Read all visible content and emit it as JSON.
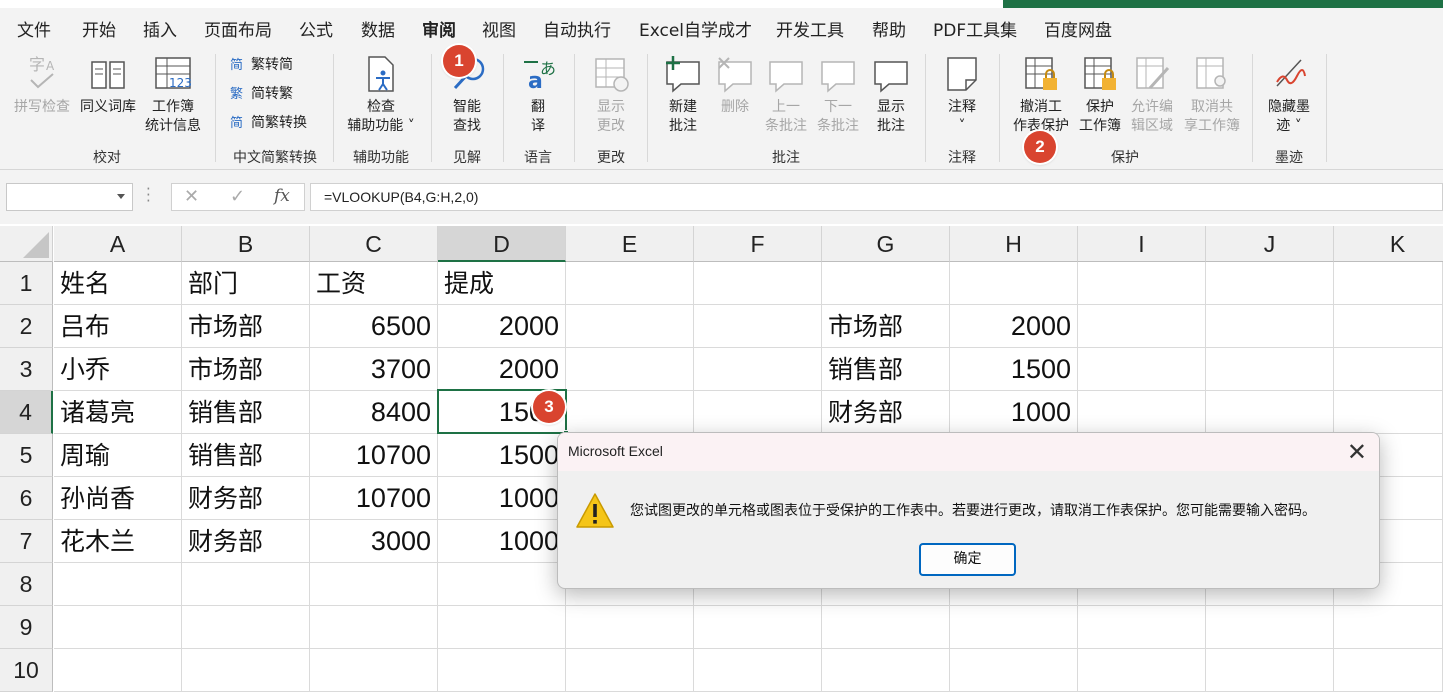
{
  "menu": {
    "items": [
      "文件",
      "开始",
      "插入",
      "页面布局",
      "公式",
      "数据",
      "审阅",
      "视图",
      "自动执行",
      "Excel自学成才",
      "开发工具",
      "帮助",
      "PDF工具集",
      "百度网盘"
    ],
    "active": "审阅"
  },
  "ribbon": {
    "spellcheck": "拼写检查",
    "thesaurus": "同义词库",
    "workbook_stats_1": "工作簿",
    "workbook_stats_2": "统计信息",
    "group_proofing": "校对",
    "trad_to_simp": "繁转简",
    "simp_to_trad": "简转繁",
    "convert": "简繁转换",
    "group_chinese": "中文简繁转换",
    "check_access_1": "检查",
    "check_access_2": "辅助功能",
    "group_access": "辅助功能",
    "smart_lookup_1": "智能",
    "smart_lookup_2": "查找",
    "group_insights": "见解",
    "translate_1": "翻",
    "translate_2": "译",
    "group_language": "语言",
    "show_changes_1": "显示",
    "show_changes_2": "更改",
    "group_changes": "更改",
    "new_comment_1": "新建",
    "new_comment_2": "批注",
    "delete_comment": "删除",
    "prev_comment_1": "上一",
    "prev_comment_2": "条批注",
    "next_comment_1": "下一",
    "next_comment_2": "条批注",
    "show_comments_1": "显示",
    "show_comments_2": "批注",
    "group_comments": "批注",
    "notes_1": "注释",
    "group_notes": "注释",
    "unprotect_sheet_1": "撤消工",
    "unprotect_sheet_2": "作表保护",
    "protect_wb_1": "保护",
    "protect_wb_2": "工作簿",
    "allow_edit_1": "允许编",
    "allow_edit_2": "辑区域",
    "unshare_1": "取消共",
    "unshare_2": "享工作簿",
    "group_protect": "保护",
    "hide_ink_1": "隐藏墨",
    "hide_ink_2": "迹",
    "group_ink": "墨迹"
  },
  "badges": [
    "1",
    "2",
    "3"
  ],
  "formula_bar": {
    "name_box": "",
    "cancel": "✕",
    "enter": "✓",
    "fx": "fx",
    "formula": "=VLOOKUP(B4,G:H,2,0)"
  },
  "sheet": {
    "columns": [
      "A",
      "B",
      "C",
      "D",
      "E",
      "F",
      "G",
      "H",
      "I",
      "J",
      "K"
    ],
    "rows": [
      "1",
      "2",
      "3",
      "4",
      "5",
      "6",
      "7",
      "8",
      "9",
      "10"
    ],
    "a": [
      "姓名",
      "吕布",
      "小乔",
      "诸葛亮",
      "周瑜",
      "孙尚香",
      "花木兰"
    ],
    "b": [
      "部门",
      "市场部",
      "市场部",
      "销售部",
      "销售部",
      "财务部",
      "财务部"
    ],
    "c": [
      "工资",
      "6500",
      "3700",
      "8400",
      "10700",
      "10700",
      "3000"
    ],
    "d": [
      "提成",
      "2000",
      "2000",
      "1500",
      "1500",
      "1000",
      "1000"
    ],
    "g": [
      "市场部",
      "销售部",
      "财务部"
    ],
    "h": [
      "2000",
      "1500",
      "1000"
    ]
  },
  "dialog": {
    "title": "Microsoft Excel",
    "message": "您试图更改的单元格或图表位于受保护的工作表中。若要进行更改，请取消工作表保护。您可能需要输入密码。",
    "ok": "确定",
    "close": "✕"
  },
  "colors": {
    "accent": "#1e7145",
    "badge": "#d9442f",
    "warning": "#f5c518"
  }
}
